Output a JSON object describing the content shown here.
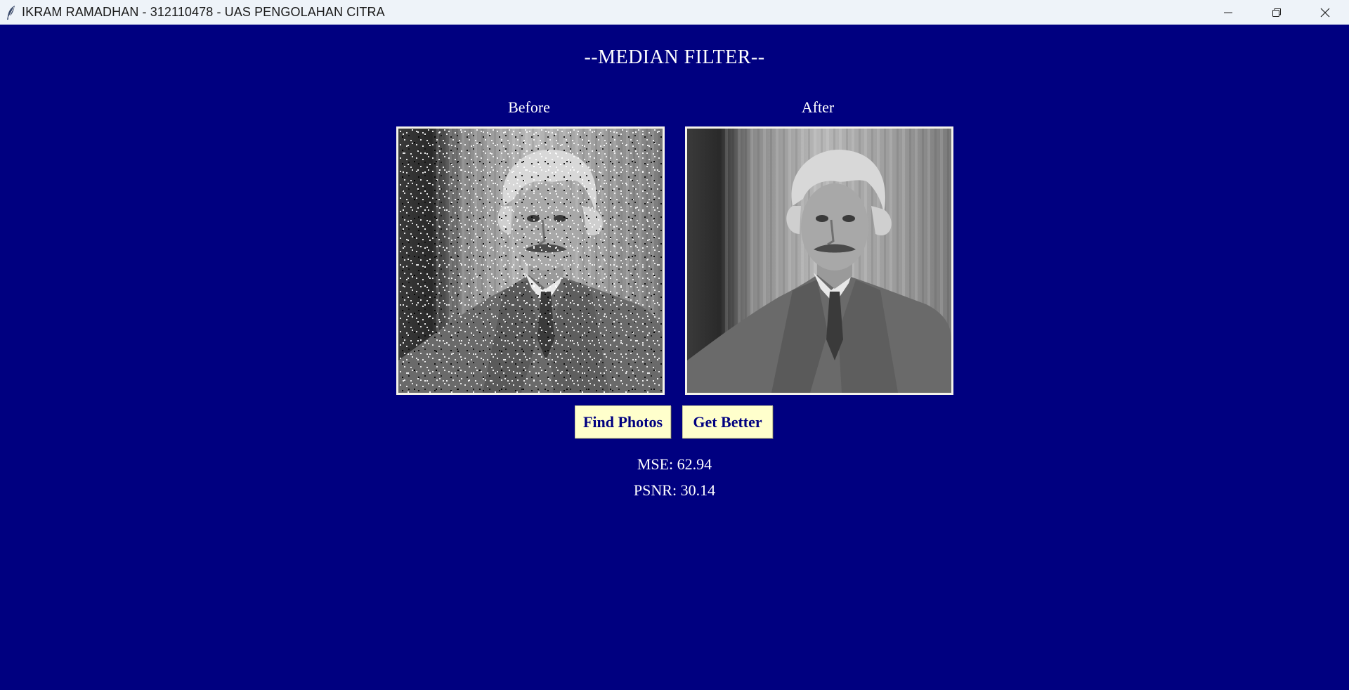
{
  "window": {
    "title": "IKRAM RAMADHAN - 312110478 - UAS PENGOLAHAN CITRA",
    "icons": [
      "feather-icon",
      "minimize-icon",
      "restore-icon",
      "close-icon"
    ]
  },
  "main": {
    "heading": "--MEDIAN FILTER--",
    "before_label": "Before",
    "after_label": "After",
    "buttons": {
      "find": "Find Photos",
      "better": "Get Better"
    },
    "metrics": {
      "mse": "MSE: 62.94",
      "psnr": "PSNR: 30.14"
    }
  },
  "colors": {
    "background": "#000080",
    "button_bg": "#ffffcc",
    "button_text": "#000080",
    "text": "#ffffff"
  }
}
